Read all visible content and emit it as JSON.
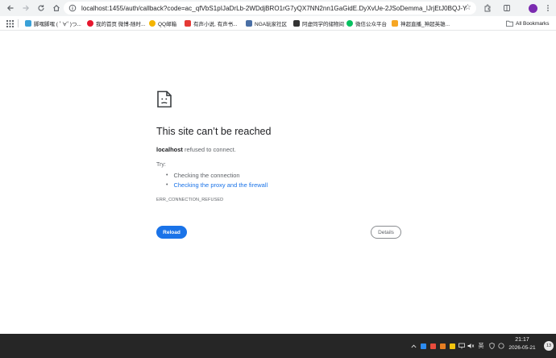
{
  "browser": {
    "url": "localhost:1455/auth/callback?code=ac_qfVbS1pIJaDrLb-2WDdjBRO1rG7yQX7NN2nn1GaGidE.DyXvUe-2JSoDemma_lJrjEtJ0BQJ-YB2C4CZ...",
    "avatar_letter": "",
    "all_bookmarks": "All Bookmarks"
  },
  "bookmarks": [
    {
      "label": "脚嘿脚嘿 ( ﾟ∀ﾟ)つ...",
      "color": "#3aa1d8"
    },
    {
      "label": "我的首页 微博-随时...",
      "color": "#e6162d"
    },
    {
      "label": "QQ邮箱",
      "color": "#f4b400"
    },
    {
      "label": "有声小说, 有声书...",
      "color": "#e53935"
    },
    {
      "label": "NGA玩家社区",
      "color": "#4a6fa5"
    },
    {
      "label": "阿虚同学的储物间",
      "color": "#333333"
    },
    {
      "label": "微信公众平台",
      "color": "#07c160"
    },
    {
      "label": "神超直播_神超英雄...",
      "color": "#f6a623"
    }
  ],
  "error": {
    "title": "This site can’t be reached",
    "host": "localhost",
    "description": " refused to connect.",
    "try_label": "Try:",
    "suggestions": [
      "Checking the connection",
      "Checking the proxy and the firewall"
    ],
    "code": "ERR_CONNECTION_REFUSED",
    "reload_label": "Reload",
    "details_label": "Details"
  },
  "taskbar": {
    "ime": "英",
    "time": "21:17",
    "date": "2026-05-21",
    "notification_count": "13"
  }
}
